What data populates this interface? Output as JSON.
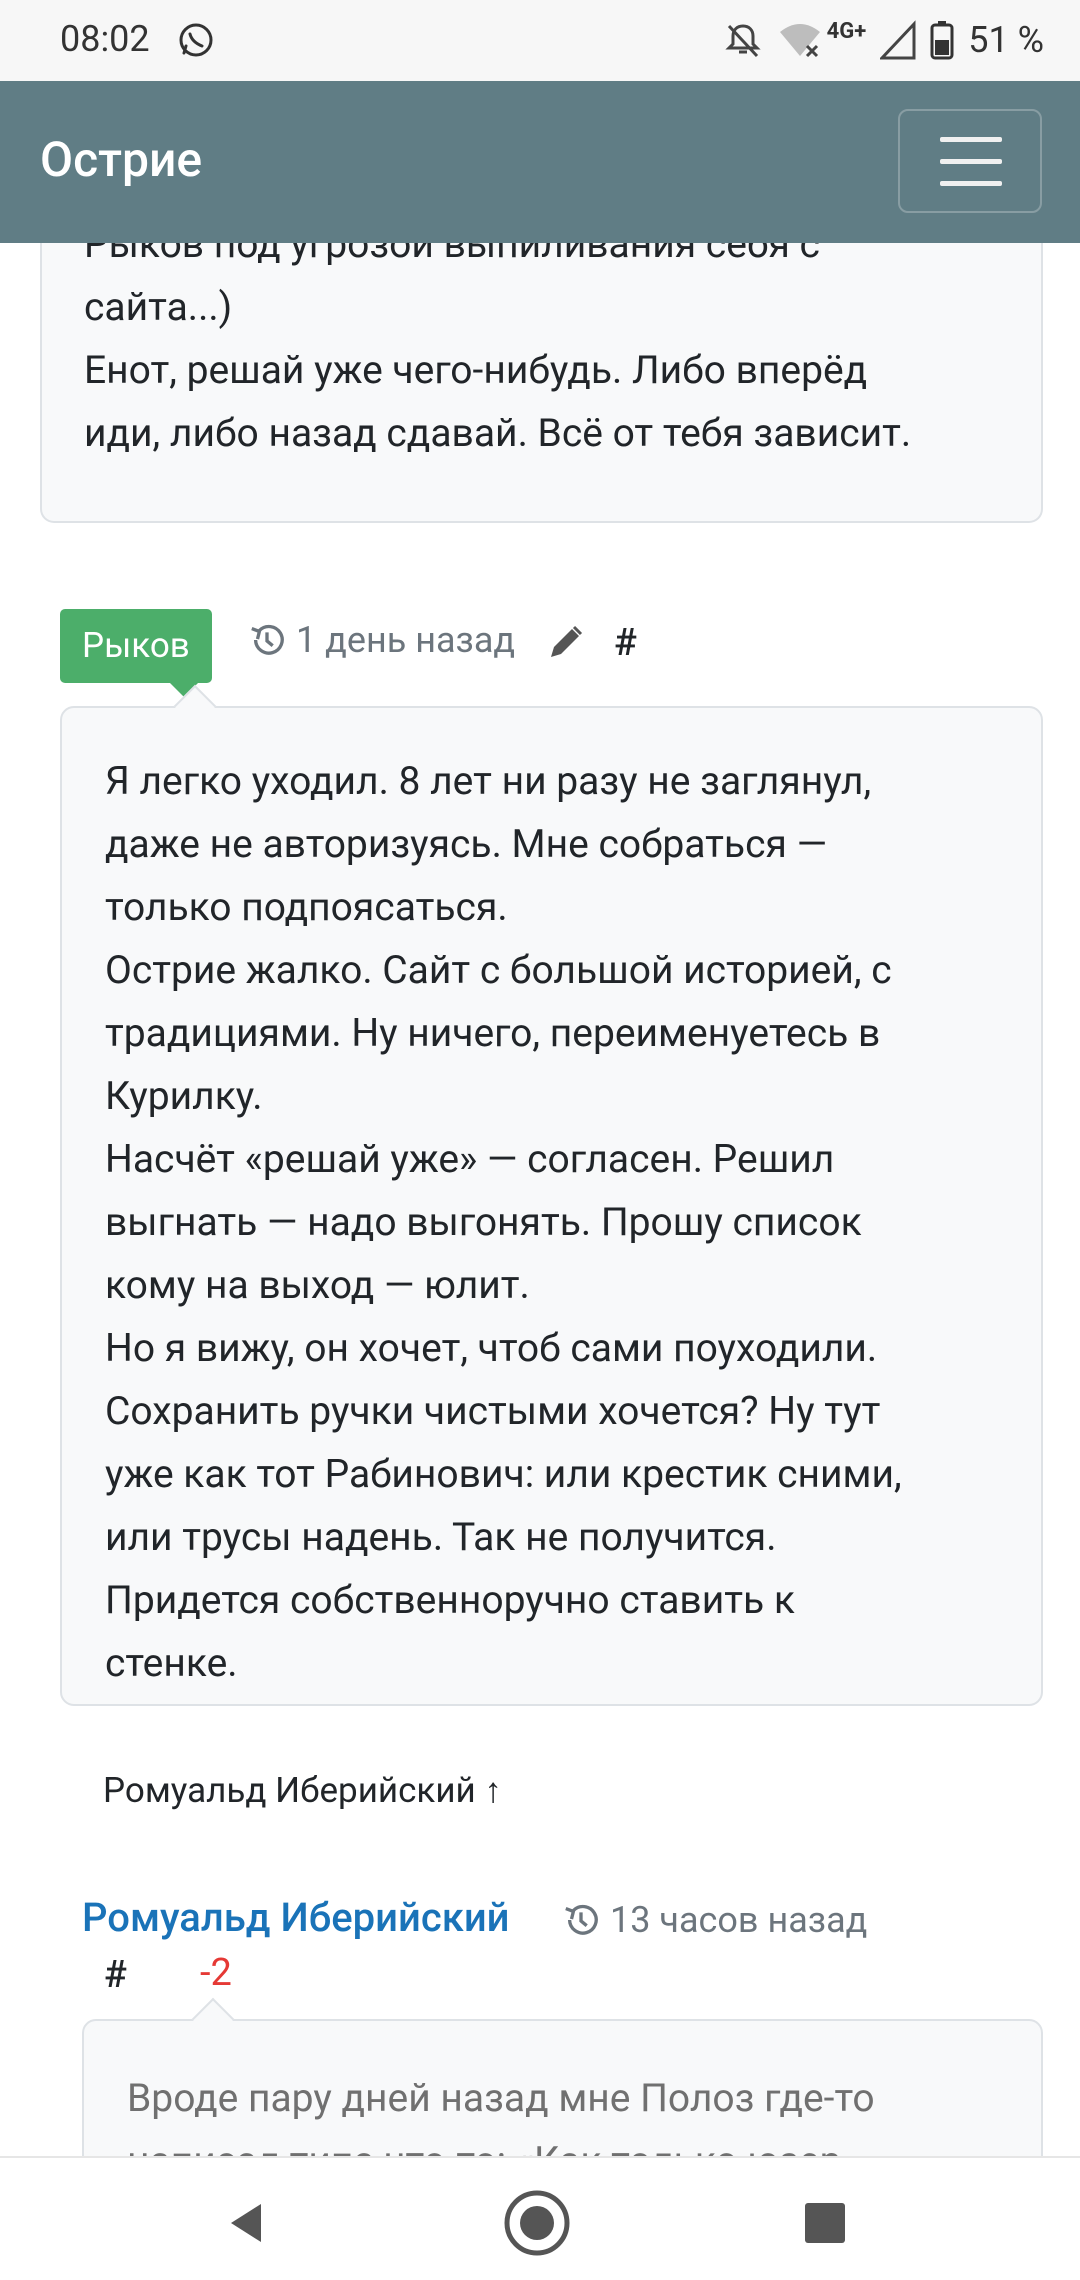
{
  "status_bar": {
    "time": "08:02",
    "network": "4G+",
    "battery_percent": "51 %"
  },
  "navbar": {
    "brand": "Острие"
  },
  "previous_comment": {
    "text_lines": [
      "Рыков под угрозой выпиливания себя с",
      "сайта...)",
      "Енот, решай уже чего-нибудь. Либо вперёд",
      "иди, либо назад сдавай. Всё от тебя зависит."
    ]
  },
  "comment": {
    "author": "Рыков",
    "time_ago": "1 день назад",
    "hash": "#",
    "text_lines": [
      "Я легко уходил. 8 лет ни разу не заглянул,",
      "даже не авторизуясь. Мне собраться —",
      "только подпоясаться.",
      "Острие жалко. Сайт с большой историей, с",
      "традициями. Ну ничего, переименуетесь в",
      "Курилку.",
      "Насчёт «решай уже» — согласен. Решил",
      "выгнать — надо выгонять. Прошу список",
      "кому на выход — юлит.",
      "Но я вижу, он хочет, чтоб сами поуходили.",
      "Сохранить ручки чистыми хочется? Ну тут",
      "уже как тот Рабинович: или крестик сними,",
      "или трусы надень. Так не получится.",
      "Придется собственноручно ставить к",
      "стенке."
    ],
    "reply_to": "Ромуальд Иберийский ↑"
  },
  "next_comment": {
    "author": "Ромуальд Иберийский",
    "time_ago": "13 часов назад",
    "hash": "#",
    "score": "-2",
    "text_lines": [
      "Вроде пару дней назад мне Полоз где-то",
      "написал типа что-то: «Как только юзер"
    ]
  },
  "colors": {
    "navbar": "#607d85",
    "author_badge": "#4cae6a",
    "author_link": "#1a73b8",
    "negative_score": "#e53935"
  }
}
